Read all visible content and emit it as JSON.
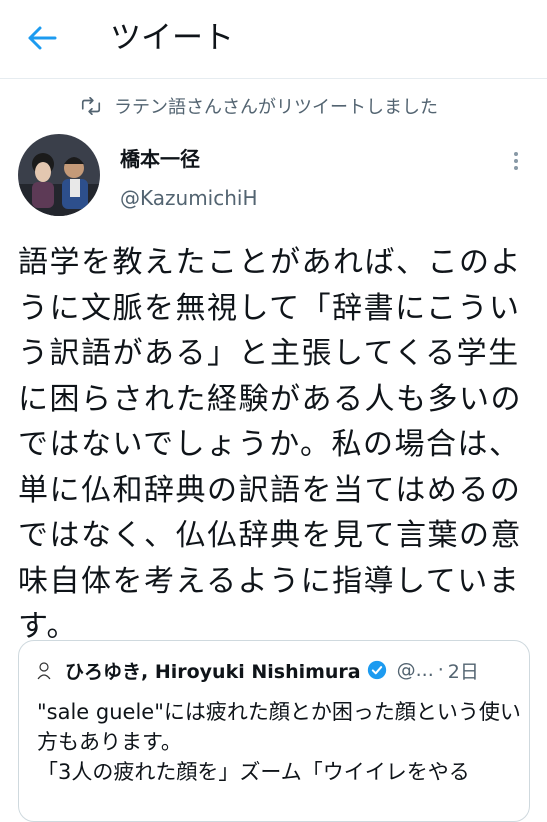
{
  "header": {
    "title": "ツイート"
  },
  "retweet": {
    "text": "ラテン語さんさんがリツイートしました"
  },
  "tweet": {
    "author_name": "橋本一径",
    "author_handle": "@KazumichiH",
    "text": "語学を教えたことがあれば、このように文脈を無視して「辞書にこういう訳語がある」と主張してくる学生に困らされた経験がある人も多いのではないでしょうか。私の場合は、単に仏和辞典の訳語を当てはめるのではなく、仏仏辞典を見て言葉の意味自体を考えるように指導しています。"
  },
  "quoted": {
    "author_name": "ひろゆき, Hiroyuki Nishimura",
    "author_handle": "@...",
    "separator": "·",
    "time": "2日",
    "text": "\"sale guele\"には疲れた顔とか困った顔という使い方もあります。\n「3人の疲れた顔を」ズーム「ウイイレをやる"
  },
  "colors": {
    "accent": "#1d9bf0",
    "secondary_text": "#536471",
    "border": "#cfd9de"
  },
  "icons": {
    "back": "arrow-left-icon",
    "retweet": "retweet-icon",
    "more": "more-vertical-icon",
    "verified": "verified-badge-icon"
  }
}
